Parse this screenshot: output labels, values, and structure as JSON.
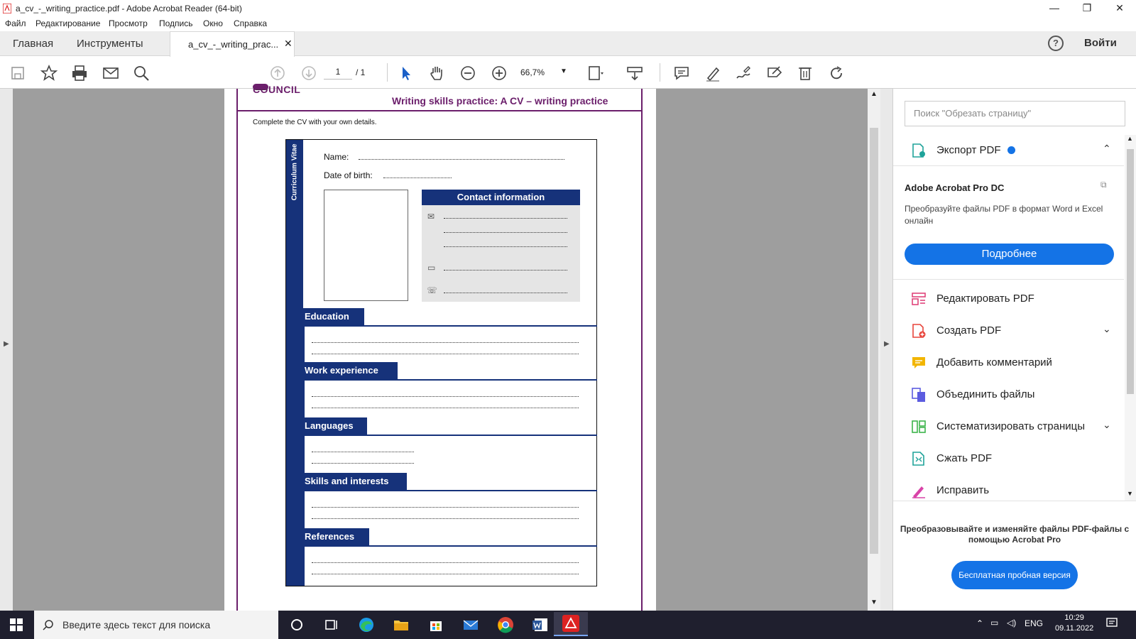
{
  "window": {
    "title": "a_cv_-_writing_practice.pdf - Adobe Acrobat Reader (64-bit)",
    "controls": {
      "minimize": "—",
      "maximize": "❐",
      "close": "✕"
    }
  },
  "menu": [
    "Файл",
    "Редактирование",
    "Просмотр",
    "Подпись",
    "Окно",
    "Справка"
  ],
  "tabs": {
    "home": "Главная",
    "tools": "Инструменты",
    "doc": "a_cv_-_writing_prac...",
    "doc_close": "✕"
  },
  "header": {
    "help": "?",
    "signin": "Войти"
  },
  "toolbar": {
    "page_current": "1",
    "page_total": "/ 1",
    "zoom": "66,7%",
    "icons": [
      "save-icon",
      "bookmark-star-icon",
      "print-icon",
      "email-icon",
      "search-zoom-icon",
      "prev-page-icon",
      "next-page-icon",
      "select-cursor-icon",
      "hand-icon",
      "zoom-out-icon",
      "zoom-in-icon",
      "fit-page-icon",
      "scroll-mode-icon",
      "comment-icon",
      "highlight-icon",
      "sign-icon",
      "fill-sign-icon",
      "delete-icon",
      "rotate-icon"
    ]
  },
  "document": {
    "brand": "COUNCIL",
    "title": "Writing skills practice: A CV – writing practice",
    "instruction": "Complete the CV with your own details.",
    "cv_side": "Curriculum Vitae",
    "name_label": "Name:",
    "dob_label": "Date of birth:",
    "contact_heading": "Contact information",
    "sections": [
      "Education",
      "Work experience",
      "Languages",
      "Skills and interests",
      "References"
    ]
  },
  "right_panel": {
    "search_placeholder": "Поиск \"Обрезать страницу\"",
    "export_title": "Экспорт PDF",
    "product": "Adobe Acrobat Pro DC",
    "product_desc": "Преобразуйте файлы PDF в формат Word и Excel онлайн",
    "more_button": "Подробнее",
    "tools": [
      {
        "label": "Редактировать PDF",
        "color": "#e0457b"
      },
      {
        "label": "Создать PDF",
        "color": "#e8453c"
      },
      {
        "label": "Добавить комментарий",
        "color": "#f2b500"
      },
      {
        "label": "Объединить файлы",
        "color": "#5c5ce0"
      },
      {
        "label": "Систематизировать страницы",
        "color": "#3cb44b"
      },
      {
        "label": "Сжать PDF",
        "color": "#1fa39a"
      },
      {
        "label": "Исправить",
        "color": "#d943a8"
      }
    ],
    "promo_text": "Преобразовывайте и изменяйте файлы PDF-файлы с помощью Acrobat Pro",
    "trial_button": "Бесплатная пробная версия"
  },
  "taskbar": {
    "search_placeholder": "Введите здесь текст для поиска",
    "lang": "ENG",
    "time": "10:29",
    "date": "09.11.2022"
  },
  "colors": {
    "accent": "#1473e6",
    "brand_purple": "#6b1e6b",
    "cv_navy": "#16327a"
  }
}
